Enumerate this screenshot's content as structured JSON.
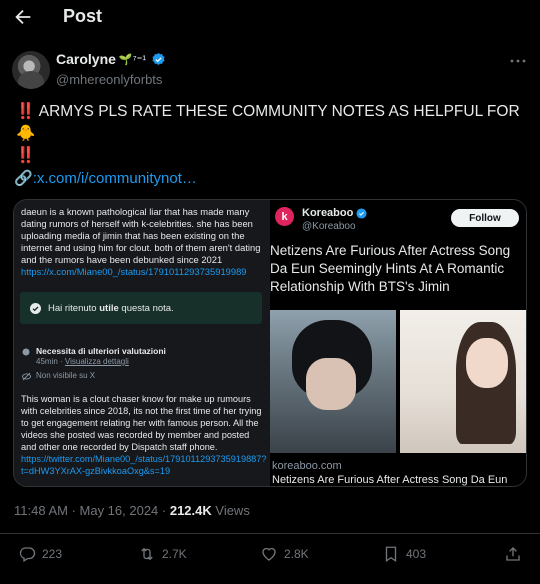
{
  "header": {
    "title": "Post"
  },
  "author": {
    "name": "Carolyne",
    "name_decoration": "🌱⁷⁼¹",
    "handle": "@mhereonlyforbts"
  },
  "post": {
    "alarm": "‼️",
    "text": "ARMYS PLS RATE THESE COMMUNITY NOTES AS HELPFUL FOR",
    "emoji": "🐥",
    "alarm2": "‼️",
    "link_icon": "🔗",
    "link_text": ":x.com/i/communitynot…"
  },
  "media": {
    "note1": {
      "text": "daeun is a known pathological liar that has made many dating rumors of herself with k-celebrities. she has been uploading media of jimin that has been existing on the internet and using him for clout. both of them aren't dating and the rumors have been debunked since 2021",
      "url": "https://x.com/Miane00_/status/1791011293735919989"
    },
    "helpful_box": {
      "text_before": "Hai ritenuto ",
      "bold": "utile",
      "text_after": " questa nota."
    },
    "rating": {
      "label": "Necessita di ulteriori valutazioni",
      "time": "45min",
      "details": "Visualizza dettagli",
      "visibility": "Non visibile su X"
    },
    "note2": {
      "text": "This woman is a clout chaser know for make up rumours with celebrities since 2018, its not the first time of her trying to get engagement relating her with famous person. All the videos she posted was recorded by member and posted and other one recorded by Dispatch staff phone.",
      "url": "https://twitter.com/Miane00_/status/1791011293735919887?t=dHW3YXrAX-gzBivkkoaOxg&s=19"
    },
    "article": {
      "source_name": "Koreaboo",
      "source_handle": "@Koreaboo",
      "follow_label": "Follow",
      "title_lines": [
        "Netizens Are Furious After Actress Song",
        "Da Eun Seemingly Hints At A Romantic",
        "Relationship With BTS's Jimin"
      ],
      "domain": "koreaboo.com",
      "card_title": "Netizens Are Furious After Actress Song Da Eun"
    }
  },
  "meta": {
    "time": "11:48 AM · May 16, 2024 · ",
    "views_count": "212.4K",
    "views_label": " Views"
  },
  "actions": {
    "replies": "223",
    "reposts": "2.7K",
    "likes": "2.8K",
    "bookmarks": "403"
  },
  "colors": {
    "accent": "#1d9bf0",
    "muted": "#71767b",
    "background": "#000000"
  }
}
